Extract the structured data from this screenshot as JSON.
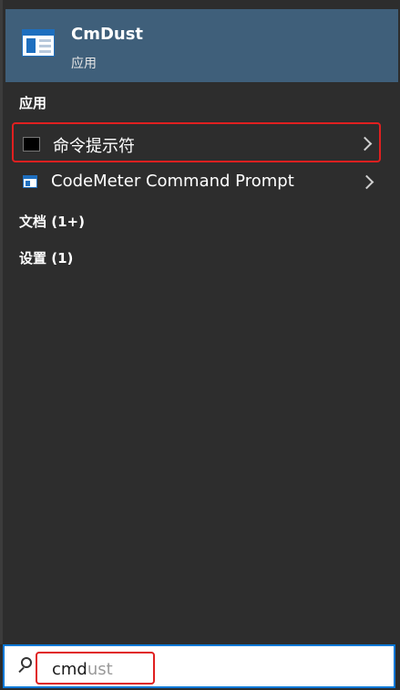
{
  "best_match": {
    "title": "CmDust",
    "subtitle": "应用",
    "icon": "app-window-icon"
  },
  "sections": {
    "apps_header": "应用",
    "documents_header": "文档 (1+)",
    "settings_header": "设置 (1)"
  },
  "apps": [
    {
      "label": "命令提示符",
      "icon": "command-prompt-icon",
      "highlighted": true
    },
    {
      "label": "CodeMeter Command Prompt",
      "icon": "codemeter-icon",
      "highlighted": false
    }
  ],
  "search": {
    "typed": "cmd",
    "suggestion": "ust"
  },
  "colors": {
    "best_match_bg": "#3f5f7a",
    "panel_bg": "#2d2d2d",
    "highlight_border": "#e02020",
    "search_border": "#0078d7"
  }
}
